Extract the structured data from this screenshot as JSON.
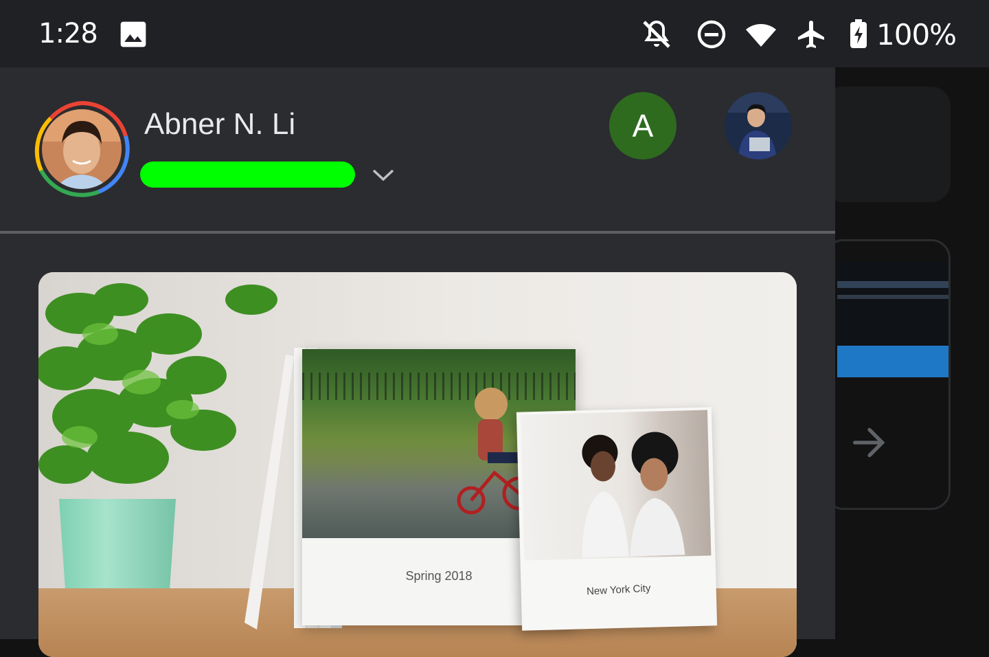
{
  "status_bar": {
    "time": "1:28",
    "battery_percent": "100%",
    "icons": [
      "image-icon",
      "notifications-off-icon",
      "do-not-disturb-icon",
      "wifi-icon",
      "airplane-mode-icon",
      "battery-charging-icon"
    ]
  },
  "account": {
    "name": "Abner N. Li",
    "secondary_account_initial": "A",
    "email_redacted": true
  },
  "promo": {
    "book_title": "Spring 2018",
    "small_book_title": "New York City"
  },
  "background_app": {
    "icon": "arrow-forward-icon"
  },
  "colors": {
    "panel": "#2b2c2f",
    "status_bar": "#202124",
    "redaction": "#00ff00",
    "account_a": "#2e6b1f"
  }
}
